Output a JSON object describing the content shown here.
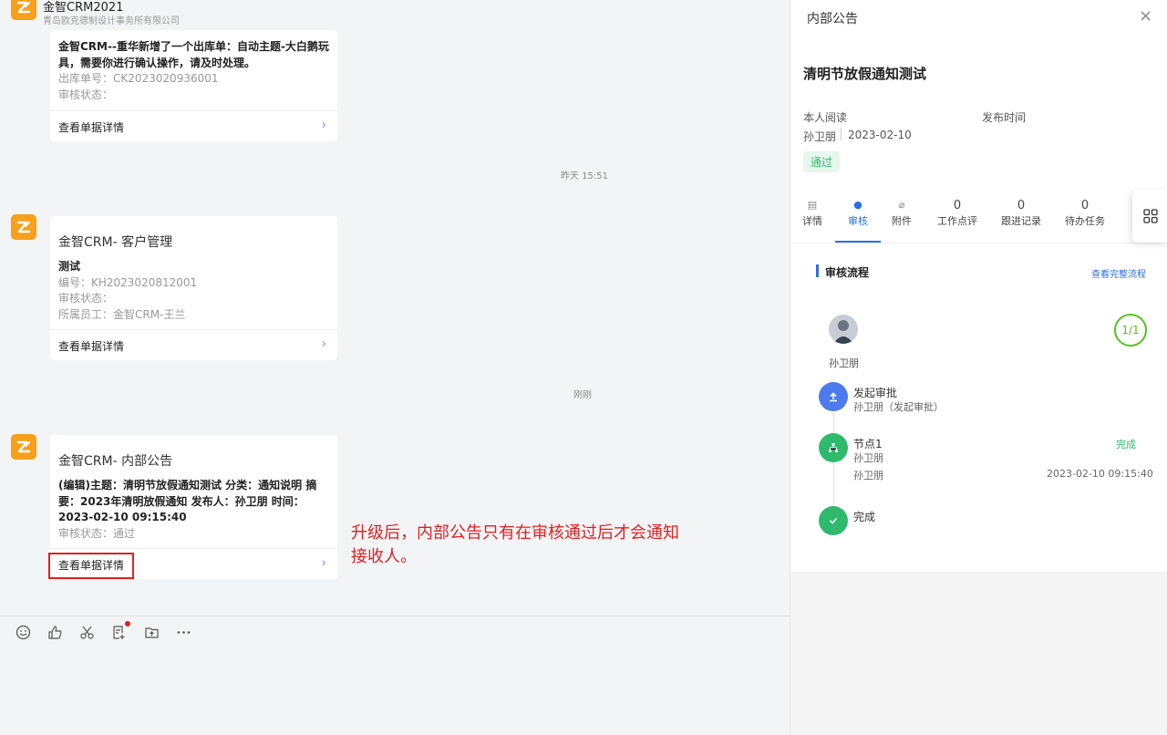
{
  "app": {
    "title": "金智CRM2021",
    "subtitle": "青岛欧克德制设计事务所有限公司"
  },
  "messages": [
    {
      "bold_text": "金智CRM--重华新增了一个出库单：自动主题-大白鹅玩具，需要你进行确认操作，请及时处理。",
      "lines": [
        "出库单号：CK2023020936001",
        "审核状态："
      ],
      "link": "查看单据详情"
    },
    {
      "title": "金智CRM- 客户管理",
      "bold_text": "测试",
      "lines": [
        "编号：KH2023020812001",
        "审核状态：",
        "所属员工：金智CRM-王兰"
      ],
      "link": "查看单据详情"
    },
    {
      "title": "金智CRM- 内部公告",
      "bold_text": "(编辑)主题：清明节放假通知测试 分类：通知说明 摘要：2023年清明放假通知 发布人：孙卫朋 时间：2023-02-10 09:15:40",
      "lines": [
        "审核状态：通过"
      ],
      "link": "查看单据详情"
    }
  ],
  "time_separators": [
    "昨天 15:51",
    "刚刚"
  ],
  "annotation": "升级后，内部公告只有在审核通过后才会通知接收人。",
  "panel": {
    "header": "内部公告",
    "title": "清明节放假通知测试",
    "read_label": "本人阅读",
    "publish_label": "发布时间",
    "author": "孙卫朋",
    "date": "2023-02-10",
    "status": "通过",
    "tabs": [
      {
        "count": "",
        "label": "详情"
      },
      {
        "count": "",
        "label": "审核"
      },
      {
        "count": "",
        "label": "附件"
      },
      {
        "count": "0",
        "label": "工作点评"
      },
      {
        "count": "0",
        "label": "跟进记录"
      },
      {
        "count": "0",
        "label": "待办任务"
      }
    ],
    "flow_title": "审核流程",
    "flow_link": "查看完整流程",
    "approver_name": "孙卫朋",
    "progress": "1/1",
    "steps": [
      {
        "title": "发起审批",
        "sub": "孙卫朋（发起审批）"
      },
      {
        "title": "节点1",
        "sub": "孙卫朋",
        "status": "完成",
        "sub2": "孙卫朋",
        "time": "2023-02-10 09:15:40"
      },
      {
        "title": "完成"
      }
    ]
  },
  "colors": {
    "brand": "#f7a01c",
    "accent": "#2a6fe4",
    "success": "#2fb96c",
    "step_start": "#4b7bec",
    "annotation": "#e02020"
  }
}
